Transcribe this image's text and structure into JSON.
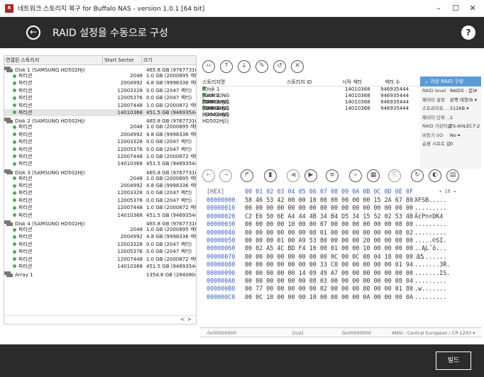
{
  "window": {
    "title": "네트워크 스토리지 복구 for Buffalo NAS - version 1.0.1 [64 bit]",
    "min": "–",
    "max": "☐",
    "close": "✕"
  },
  "header": {
    "back": "←",
    "title": "RAID 설정을 수동으로 구성",
    "help": "?"
  },
  "left": {
    "col_storage": "연결된 스토리지",
    "col_start": "Start Sector",
    "col_size": "크기",
    "rows": [
      {
        "type": "disk",
        "label": "Disk 1 (SAMSUNG HD502HJ)",
        "start": "",
        "size": "465.8 GB (976773168 섹터)"
      },
      {
        "type": "part",
        "label": "파티션",
        "start": "2048",
        "size": "1.0 GB (2000895 섹터)"
      },
      {
        "type": "part",
        "label": "파티션",
        "start": "2004992",
        "size": "4.8 GB (9998336 섹터)"
      },
      {
        "type": "part",
        "label": "파티션",
        "start": "12003328",
        "size": "0.0 GB (2047 섹터)"
      },
      {
        "type": "part",
        "label": "파티션",
        "start": "12005376",
        "size": "0.0 GB (2047 섹터)"
      },
      {
        "type": "part",
        "label": "파티션",
        "start": "12007448",
        "size": "1.0 GB (2000872 섹터)"
      },
      {
        "type": "part",
        "label": "파티션",
        "start": "14010368",
        "size": "451.5 GB (946935444 섹터)",
        "sel": true
      },
      {
        "type": "disk",
        "label": "Disk 2 (SAMSUNG HD502HJ)",
        "start": "",
        "size": "465.8 GB (976773168 섹터)"
      },
      {
        "type": "part",
        "label": "파티션",
        "start": "2048",
        "size": "1.0 GB (2000895 섹터)"
      },
      {
        "type": "part",
        "label": "파티션",
        "start": "2004992",
        "size": "4.8 GB (9998336 섹터)"
      },
      {
        "type": "part",
        "label": "파티션",
        "start": "12003328",
        "size": "0.0 GB (2047 섹터)"
      },
      {
        "type": "part",
        "label": "파티션",
        "start": "12005376",
        "size": "0.0 GB (2047 섹터)"
      },
      {
        "type": "part",
        "label": "파티션",
        "start": "12007448",
        "size": "1.0 GB (2000872 섹터)"
      },
      {
        "type": "part",
        "label": "파티션",
        "start": "14010368",
        "size": "451.5 GB (946935444 섹터)"
      },
      {
        "type": "disk",
        "label": "Disk 3 (SAMSUNG HD502HJ)",
        "start": "",
        "size": "465.8 GB (976773168 섹터)"
      },
      {
        "type": "part",
        "label": "파티션",
        "start": "2048",
        "size": "1.0 GB (2000895 섹터)"
      },
      {
        "type": "part",
        "label": "파티션",
        "start": "2004992",
        "size": "4.8 GB (9998336 섹터)"
      },
      {
        "type": "part",
        "label": "파티션",
        "start": "12003328",
        "size": "0.0 GB (2047 섹터)"
      },
      {
        "type": "part",
        "label": "파티션",
        "start": "12005376",
        "size": "0.0 GB (2047 섹터)"
      },
      {
        "type": "part",
        "label": "파티션",
        "start": "12007448",
        "size": "1.0 GB (2000872 섹터)"
      },
      {
        "type": "part",
        "label": "파티션",
        "start": "14010368",
        "size": "451.5 GB (946935444 섹터)"
      },
      {
        "type": "disk",
        "label": "Disk 4 (SAMSUNG HD502HJ)",
        "start": "",
        "size": "465.8 GB (976773168 섹터)"
      },
      {
        "type": "part",
        "label": "파티션",
        "start": "2048",
        "size": "1.0 GB (2000895 섹터)"
      },
      {
        "type": "part",
        "label": "파티션",
        "start": "2004992",
        "size": "4.8 GB (9998336 섹터)"
      },
      {
        "type": "part",
        "label": "파티션",
        "start": "12003328",
        "size": "0.0 GB (2047 섹터)"
      },
      {
        "type": "part",
        "label": "파티션",
        "start": "12005376",
        "size": "0.0 GB (2047 섹터)"
      },
      {
        "type": "part",
        "label": "파티션",
        "start": "12007448",
        "size": "1.0 GB (2000872 섹터)"
      },
      {
        "type": "part",
        "label": "파티션",
        "start": "14010368",
        "size": "451.5 GB (946935444 섹터)"
      },
      {
        "type": "disk",
        "label": "Array 1",
        "start": "",
        "size": "1354.6 GB (2840804352 섹터)"
      }
    ],
    "scroll": "<  >"
  },
  "store": {
    "col_name": "스토리지명",
    "col_id": "스토리지 ID",
    "col_start": "시작 섹터",
    "col_count": "섹터 수",
    "rows": [
      {
        "name": "[Disk 1 (SAMSUNG HD502HJ)]",
        "start": "14010368",
        "count": "946935444"
      },
      {
        "name": "[Disk 2 (SAMSUNG HD502HJ)]",
        "start": "14010368",
        "count": "946935444"
      },
      {
        "name": "[Disk 3 (SAMSUNG HD502HJ)]",
        "start": "14010368",
        "count": "946935444"
      },
      {
        "name": "[Disk 4 (SAMSUNG HD502HJ)]",
        "start": "14010368",
        "count": "946935444"
      }
    ]
  },
  "raid": {
    "title": "가상 RAID 구성",
    "props": [
      {
        "label": "RAID level",
        "value": "RAID5 - 문(▾"
      },
      {
        "label": "패리티 설정",
        "value": "왼쪽 대칭(b ▾"
      },
      {
        "label": "스트라이프 ...",
        "value": "512KB ▾"
      },
      {
        "label": "패리티 단위 ...",
        "value": "1"
      },
      {
        "label": "RAID 가상이름",
        "value": "TS-XHLEC7:2"
      },
      {
        "label": "비동기 I/O",
        "value": "No ▾"
      },
      {
        "label": "순환 시프트 값",
        "value": "0"
      }
    ]
  },
  "hex": {
    "head_label": "[HEX]",
    "head_cols": "00 01 02 03 04 05 06 07 08 09 0A 0B 0C 0D 0E 0F",
    "head_page": "◂ 16 ▸",
    "rows": [
      {
        "off": "00000000",
        "bytes": "58 46 53 42 00 00 10 00 00 00 00 00 15 2A 67 80",
        "ascii": "XFSB....."
      },
      {
        "off": "00000010",
        "bytes": "00 00 00 00 00 00 00 00 00 00 00 00 00 00 00 00",
        "ascii": "........."
      },
      {
        "off": "00000020",
        "bytes": "C2 E6 50 6E A4 44 4B 34 B4 D5 34 15 52 02 53 4B",
        "ascii": "ÂćPn¤DK4"
      },
      {
        "off": "00000030",
        "bytes": "00 00 00 00 10 00 00 07 00 00 00 00 00 00 08 00",
        "ascii": "........."
      },
      {
        "off": "00000040",
        "bytes": "00 00 00 00 00 00 08 01 00 00 00 00 00 00 08 02",
        "ascii": "........."
      },
      {
        "off": "00000050",
        "bytes": "00 00 00 01 00 A9 53 80 00 00 00 20 00 00 00 00",
        "ascii": ".....©SI."
      },
      {
        "off": "00000060",
        "bytes": "00 02 A5 4C BD F4 10 00 01 00 00 10 00 00 00 00",
        "ascii": "..ĄL˝ô..."
      },
      {
        "off": "00000070",
        "bytes": "00 00 00 00 00 00 00 00 0C 00 0C 08 04 18 00 00 05",
        "ascii": "........."
      },
      {
        "off": "00000080",
        "bytes": "00 00 00 00 00 00 00 33 C0 00 00 00 00 00 01 94",
        "ascii": ".......3Ŕ."
      },
      {
        "off": "00000090",
        "bytes": "00 00 00 00 00 14 09 49 A7 00 00 00 00 00 00 00",
        "ascii": ".......IS."
      },
      {
        "off": "000000A0",
        "bytes": "00 00 00 00 00 00 08 03 00 00 00 00 00 00 08 04",
        "ascii": "........."
      },
      {
        "off": "000000B0",
        "bytes": "00 77 00 00 00 00 00 02 00 00 00 80 00 00 01 80",
        "ascii": ".w......."
      },
      {
        "off": "000000C0",
        "bytes": "00 0C 10 00 00 00 10 00 00 00 00 0A 00 00 00 0A",
        "ascii": "........."
      }
    ]
  },
  "status": {
    "offset": "0x00000000",
    "na": "[n/a]",
    "offset2": "0x00000000",
    "encoding": "ANSI - Central European / CP-1250 ▾"
  },
  "footer": {
    "build": "빌드"
  }
}
